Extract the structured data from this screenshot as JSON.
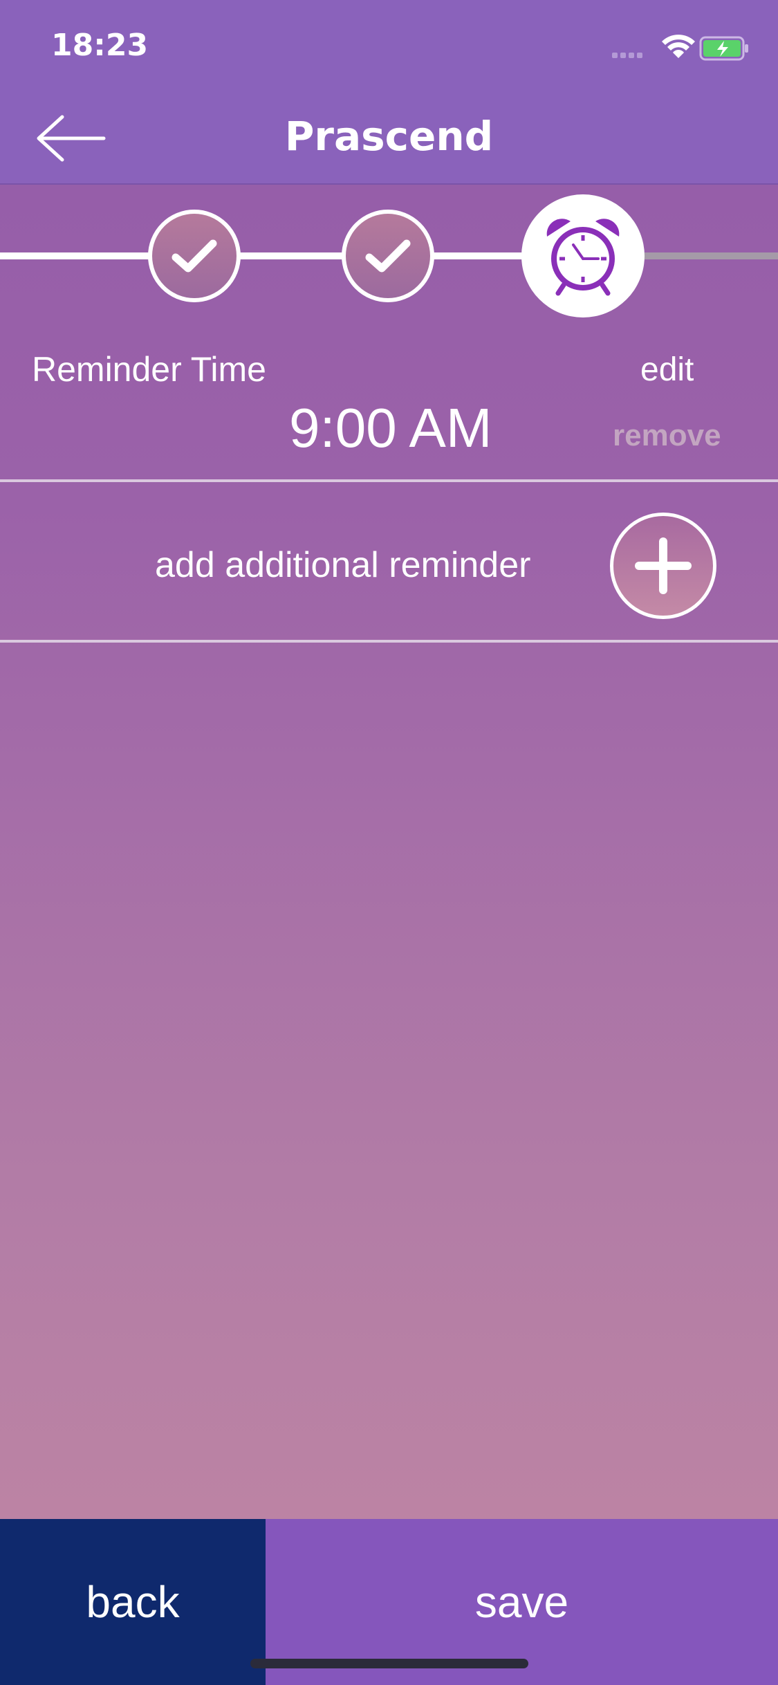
{
  "status_bar": {
    "time": "18:23"
  },
  "header": {
    "title": "Prascend"
  },
  "progress": {
    "steps": [
      {
        "state": "done",
        "icon": "check-icon"
      },
      {
        "state": "done",
        "icon": "check-icon"
      },
      {
        "state": "current",
        "icon": "alarm-clock-icon"
      }
    ]
  },
  "reminder": {
    "label": "Reminder Time",
    "time": "9:00 AM",
    "edit_label": "edit",
    "remove_label": "remove"
  },
  "add_reminder": {
    "label": "add additional reminder",
    "icon": "plus-icon"
  },
  "footer": {
    "back_label": "back",
    "save_label": "save"
  },
  "colors": {
    "header_bg": "#8a62bb",
    "back_button_bg": "#0f296d",
    "save_button_bg": "#8556bc",
    "alarm_icon": "#8a2fb8",
    "remove_text": "#c3a5c1"
  }
}
